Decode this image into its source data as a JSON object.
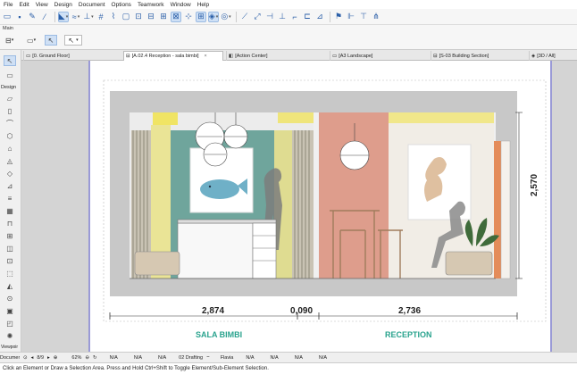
{
  "menu": [
    "File",
    "Edit",
    "View",
    "Design",
    "Document",
    "Options",
    "Teamwork",
    "Window",
    "Help"
  ],
  "infobox": {
    "label": "Main"
  },
  "tabs": [
    {
      "label": "[0. Ground Floor]",
      "active": false
    },
    {
      "label": "[A.02.4 Reception - sala bimbi]",
      "active": true
    },
    {
      "label": "[Action Center]",
      "active": false
    },
    {
      "label": "[A3 Landscape]",
      "active": false
    },
    {
      "label": "[S-03 Building Section]",
      "active": false
    },
    {
      "label": "[3D / All]",
      "active": false
    }
  ],
  "toolbox": {
    "design_label": "Design",
    "viewpoint_label": "Viewpoir",
    "document_label": "Documer"
  },
  "drawing": {
    "dim_left": "2,874",
    "dim_mid": "0,090",
    "dim_right": "2,736",
    "dim_height": "2,570",
    "label_left": "SALA BIMBI",
    "label_right": "RECEPTION",
    "accent_color": "#2aa38e"
  },
  "status": {
    "page": "8/9",
    "zoom": "62%",
    "na1": "N/A",
    "na2": "N/A",
    "na3": "N/A",
    "layer": "02 Drafting",
    "pen": "Flavia",
    "na4": "N/A",
    "na5": "N/A",
    "na6": "N/A",
    "na7": "N/A"
  },
  "footer_text": "Click an Element or Draw a Selection Area. Press and Hold Ctrl+Shift to Toggle Element/Sub-Element Selection."
}
